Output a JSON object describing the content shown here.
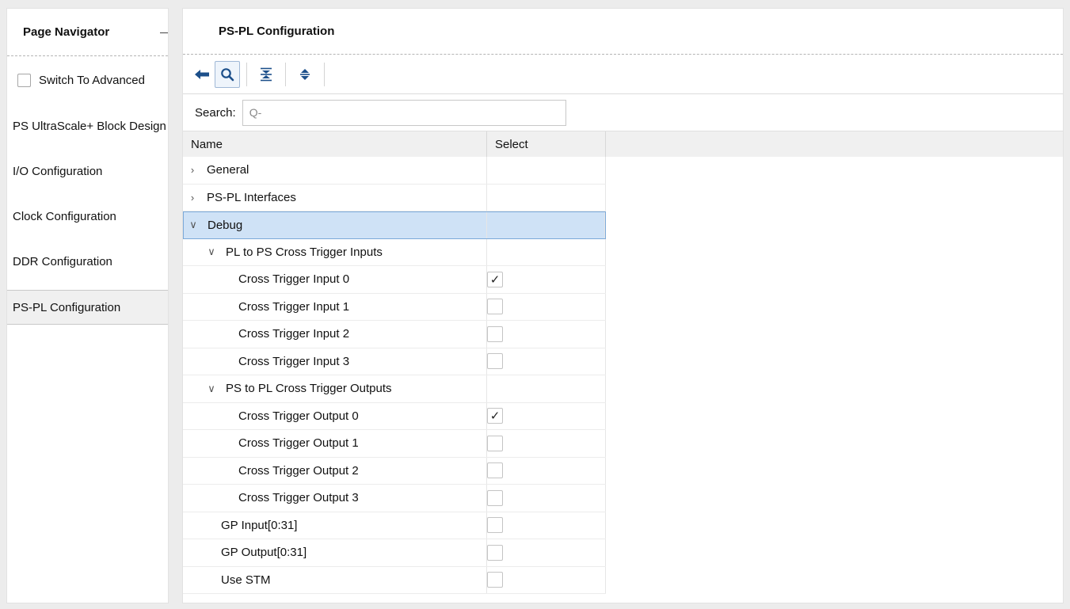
{
  "navigator": {
    "title": "Page Navigator",
    "advanced_label": "Switch To Advanced",
    "items": [
      {
        "label": "PS UltraScale+ Block Design"
      },
      {
        "label": "I/O Configuration"
      },
      {
        "label": "Clock Configuration"
      },
      {
        "label": "DDR Configuration"
      },
      {
        "label": "PS-PL Configuration",
        "selected": true
      }
    ]
  },
  "main": {
    "title": "PS-PL Configuration",
    "toolbar": [
      "back-arrow-icon",
      "search-icon",
      "collapse-all-icon",
      "expand-all-icon"
    ],
    "search": {
      "label": "Search:",
      "placeholder": "Q-"
    },
    "columns": {
      "name": "Name",
      "select": "Select"
    },
    "rows": [
      {
        "label": "General",
        "level": 0,
        "expand": "collapsed",
        "checked": null
      },
      {
        "label": "PS-PL Interfaces",
        "level": 0,
        "expand": "collapsed",
        "checked": null
      },
      {
        "label": "Debug",
        "level": 0,
        "expand": "expanded",
        "checked": null,
        "selected": true
      },
      {
        "label": "PL to PS Cross Trigger Inputs",
        "level": 1,
        "expand": "expanded",
        "checked": null
      },
      {
        "label": "Cross Trigger Input 0",
        "level": 2,
        "expand": null,
        "checked": true
      },
      {
        "label": "Cross Trigger Input 1",
        "level": 2,
        "expand": null,
        "checked": false
      },
      {
        "label": "Cross Trigger Input 2",
        "level": 2,
        "expand": null,
        "checked": false
      },
      {
        "label": "Cross Trigger Input 3",
        "level": 2,
        "expand": null,
        "checked": false
      },
      {
        "label": "PS to PL Cross Trigger Outputs",
        "level": 1,
        "expand": "expanded",
        "checked": null
      },
      {
        "label": "Cross Trigger Output 0",
        "level": 2,
        "expand": null,
        "checked": true
      },
      {
        "label": "Cross Trigger Output 1",
        "level": 2,
        "expand": null,
        "checked": false
      },
      {
        "label": "Cross Trigger Output 2",
        "level": 2,
        "expand": null,
        "checked": false
      },
      {
        "label": "Cross Trigger Output 3",
        "level": 2,
        "expand": null,
        "checked": false
      },
      {
        "label": "GP Input[0:31]",
        "level": 1,
        "expand": null,
        "checked": false
      },
      {
        "label": "GP Output[0:31]",
        "level": 1,
        "expand": null,
        "checked": false
      },
      {
        "label": "Use STM",
        "level": 1,
        "expand": null,
        "checked": false
      }
    ]
  },
  "colors": {
    "selection": "#cfe2f6",
    "accent": "#1c4f8a"
  }
}
